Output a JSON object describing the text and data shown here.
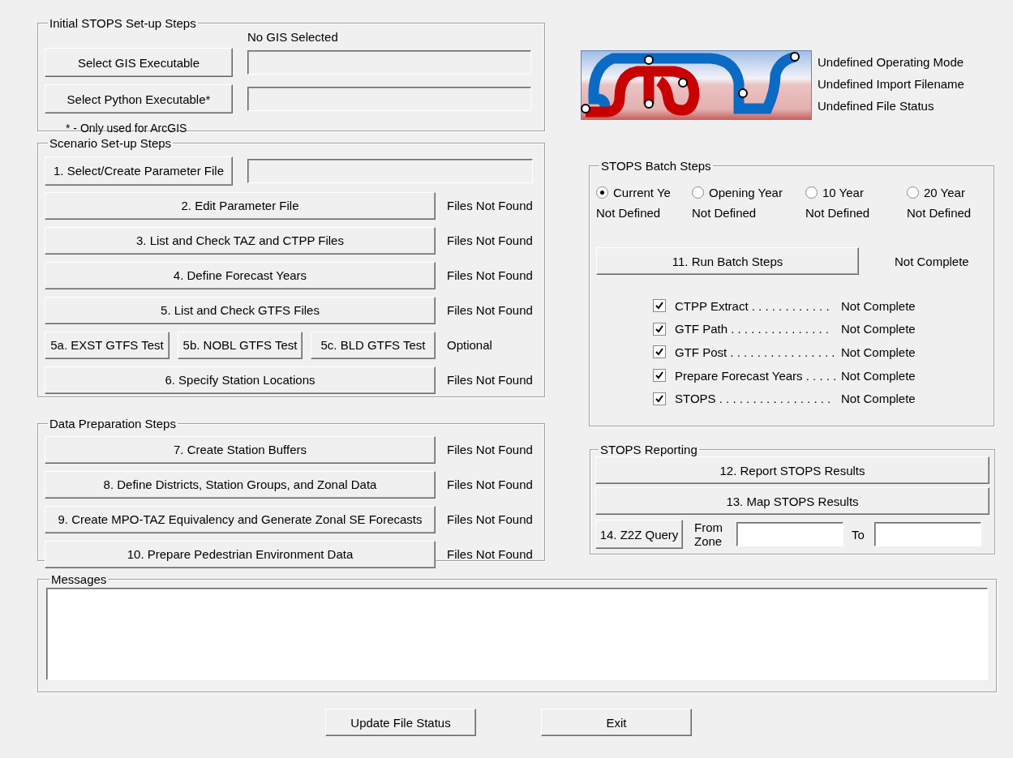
{
  "initial_setup": {
    "title": "Initial STOPS Set-up Steps",
    "gis_status": "No GIS Selected",
    "rows": [
      {
        "button": "Select GIS Executable"
      },
      {
        "button": "Select Python Executable*"
      }
    ],
    "note": "* - Only used for ArcGIS"
  },
  "scenario_setup": {
    "title": "Scenario Set-up Steps",
    "steps": [
      {
        "kind": "field",
        "button": "1. Select/Create Parameter File"
      },
      {
        "kind": "status",
        "button": "2. Edit Parameter File",
        "status": "Files Not Found"
      },
      {
        "kind": "status",
        "button": "3. List and Check TAZ and CTPP Files",
        "status": "Files Not Found"
      },
      {
        "kind": "status",
        "button": "4. Define Forecast Years",
        "status": "Files Not Found"
      },
      {
        "kind": "status",
        "button": "5. List and Check GTFS Files",
        "status": "Files Not Found"
      },
      {
        "kind": "triple",
        "buttons": [
          "5a. EXST GTFS Test",
          "5b. NOBL GTFS Test",
          "5c. BLD GTFS Test"
        ],
        "status": "Optional"
      },
      {
        "kind": "status",
        "button": "6. Specify Station Locations",
        "status": "Files Not Found"
      }
    ]
  },
  "data_preparation": {
    "title": "Data Preparation Steps",
    "steps": [
      {
        "button": "7. Create Station Buffers",
        "status": "Files Not Found"
      },
      {
        "button": "8. Define Districts, Station Groups, and Zonal Data",
        "status": "Files Not Found"
      },
      {
        "button": "9. Create MPO-TAZ Equivalency and Generate Zonal SE Forecasts",
        "status": "Files Not Found"
      },
      {
        "button": "10. Prepare Pedestrian Environment Data",
        "status": "Files Not Found"
      }
    ]
  },
  "logo_status": [
    "Undefined Operating Mode",
    "Undefined Import Filename",
    "Undefined File Status"
  ],
  "batch": {
    "title": "STOPS Batch Steps",
    "years": [
      {
        "label": "Current Ye",
        "selected": true,
        "status": "Not Defined"
      },
      {
        "label": "Opening Year",
        "selected": false,
        "status": "Not Defined"
      },
      {
        "label": "10 Year",
        "selected": false,
        "status": "Not Defined"
      },
      {
        "label": "20 Year",
        "selected": false,
        "status": "Not Defined"
      }
    ],
    "run_button": "11. Run Batch Steps",
    "run_status": "Not Complete",
    "checks": [
      {
        "label": "CTPP Extract . . . . . . . . . . . .",
        "checked": true,
        "status": "Not Complete"
      },
      {
        "label": "GTF Path . . . . . . . . . . . . . . .",
        "checked": true,
        "status": "Not Complete"
      },
      {
        "label": "GTF Post . . . . . . . . . . . . . . . .",
        "checked": true,
        "status": "Not Complete"
      },
      {
        "label": "Prepare Forecast Years . . . . .",
        "checked": true,
        "status": "Not Complete"
      },
      {
        "label": "STOPS . . . . . . . . . . . . . . . . .",
        "checked": true,
        "status": "Not Complete"
      }
    ]
  },
  "reporting": {
    "title": "STOPS Reporting",
    "buttons": [
      "12. Report STOPS Results",
      "13. Map STOPS Results"
    ],
    "query_button": "14. Z2Z Query",
    "from_label": "From Zone",
    "to_label": "To"
  },
  "messages": {
    "title": "Messages"
  },
  "footer_buttons": [
    "Update File Status",
    "Exit"
  ]
}
